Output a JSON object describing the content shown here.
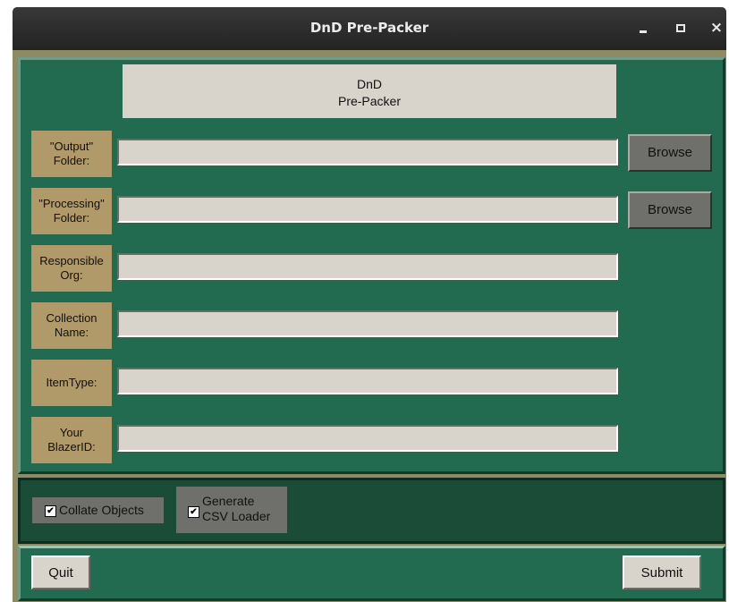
{
  "window": {
    "title": "DnD Pre-Packer",
    "minimize_icon": "minimize-icon",
    "maximize_icon": "maximize-icon",
    "close_glyph": "×"
  },
  "header": {
    "line1": "DnD",
    "line2": "Pre-Packer"
  },
  "fields": [
    {
      "label_line1": "\"Output\"",
      "label_line2": "Folder:",
      "value": "",
      "browse_label": "Browse"
    },
    {
      "label_line1": "\"Processing\"",
      "label_line2": "Folder:",
      "value": "",
      "browse_label": "Browse"
    },
    {
      "label_line1": "Responsible",
      "label_line2": "Org:",
      "value": ""
    },
    {
      "label_line1": "Collection",
      "label_line2": "Name:",
      "value": ""
    },
    {
      "label_line1": "ItemType:",
      "label_line2": "",
      "value": ""
    },
    {
      "label_line1": "Your",
      "label_line2": "BlazerID:",
      "value": ""
    }
  ],
  "options": {
    "collate": {
      "label": "Collate Objects",
      "checked": true,
      "mark": "✔"
    },
    "csv": {
      "label_line1": "Generate",
      "label_line2": "CSV Loader",
      "checked": true,
      "mark": "✔"
    }
  },
  "actions": {
    "quit_label": "Quit",
    "submit_label": "Submit"
  },
  "colors": {
    "panel": "#226b50",
    "label_bg": "#b09a6a",
    "button_gray": "#6f706b",
    "field_bg": "#d8d4cc"
  }
}
